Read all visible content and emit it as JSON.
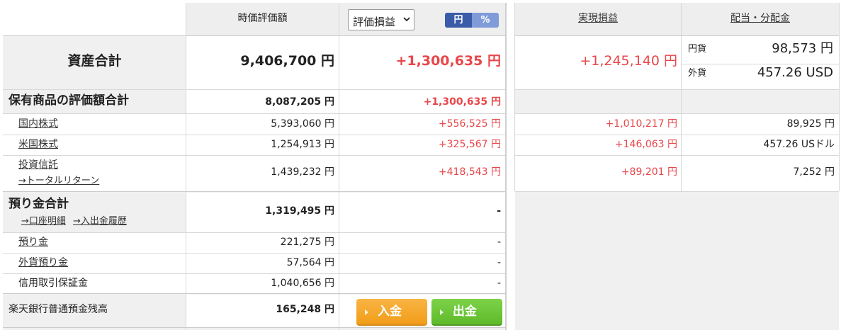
{
  "header": {
    "col_valuation": "時価評価額",
    "pnl_select": "評価損益",
    "toggle_yen": "円",
    "toggle_pct": "%",
    "col_realized": "実現損益",
    "col_dividend": "配当・分配金"
  },
  "total_assets": {
    "label": "資産合計",
    "valuation": "9,406,700 円",
    "pnl": "+1,300,635 円",
    "realized": "+1,245,140 円",
    "dividend_yen_label": "円貨",
    "dividend_yen_value": "98,573 円",
    "dividend_fx_label": "外貨",
    "dividend_fx_value": "457.26 USD"
  },
  "holdings": {
    "label": "保有商品の評価額合計",
    "valuation": "8,087,205 円",
    "pnl": "+1,300,635 円",
    "rows": [
      {
        "label": "国内株式",
        "valuation": "5,393,060 円",
        "pnl": "+556,525 円",
        "realized": "+1,010,217 円",
        "dividend": "89,925 円"
      },
      {
        "label": "米国株式",
        "valuation": "1,254,913 円",
        "pnl": "+325,567 円",
        "realized": "+146,063 円",
        "dividend": "457.26 USドル"
      },
      {
        "label": "投資信託",
        "sublink": "→トータルリターン",
        "valuation": "1,439,232 円",
        "pnl": "+418,543 円",
        "realized": "+89,201 円",
        "dividend": "7,252 円"
      }
    ]
  },
  "deposits": {
    "label": "預り金合計",
    "link_account": "→口座明細",
    "link_history": "→入出金履歴",
    "valuation": "1,319,495 円",
    "pnl": "-",
    "rows": [
      {
        "label": "預り金",
        "valuation": "221,275 円",
        "pnl": "-"
      },
      {
        "label": "外貨預り金",
        "valuation": "57,564 円",
        "pnl": "-"
      },
      {
        "label": "信用取引保証金",
        "valuation": "1,040,656 円",
        "pnl": "-"
      }
    ]
  },
  "bank": {
    "label": "楽天銀行普通預金残高",
    "valuation": "165,248 円",
    "deposit_button": "入金",
    "withdraw_button": "出金"
  },
  "colors": {
    "positive": "#e8464a",
    "deposit_button": "#f2a124",
    "withdraw_button": "#66c030",
    "toggle_active": "#3a5ba8"
  }
}
